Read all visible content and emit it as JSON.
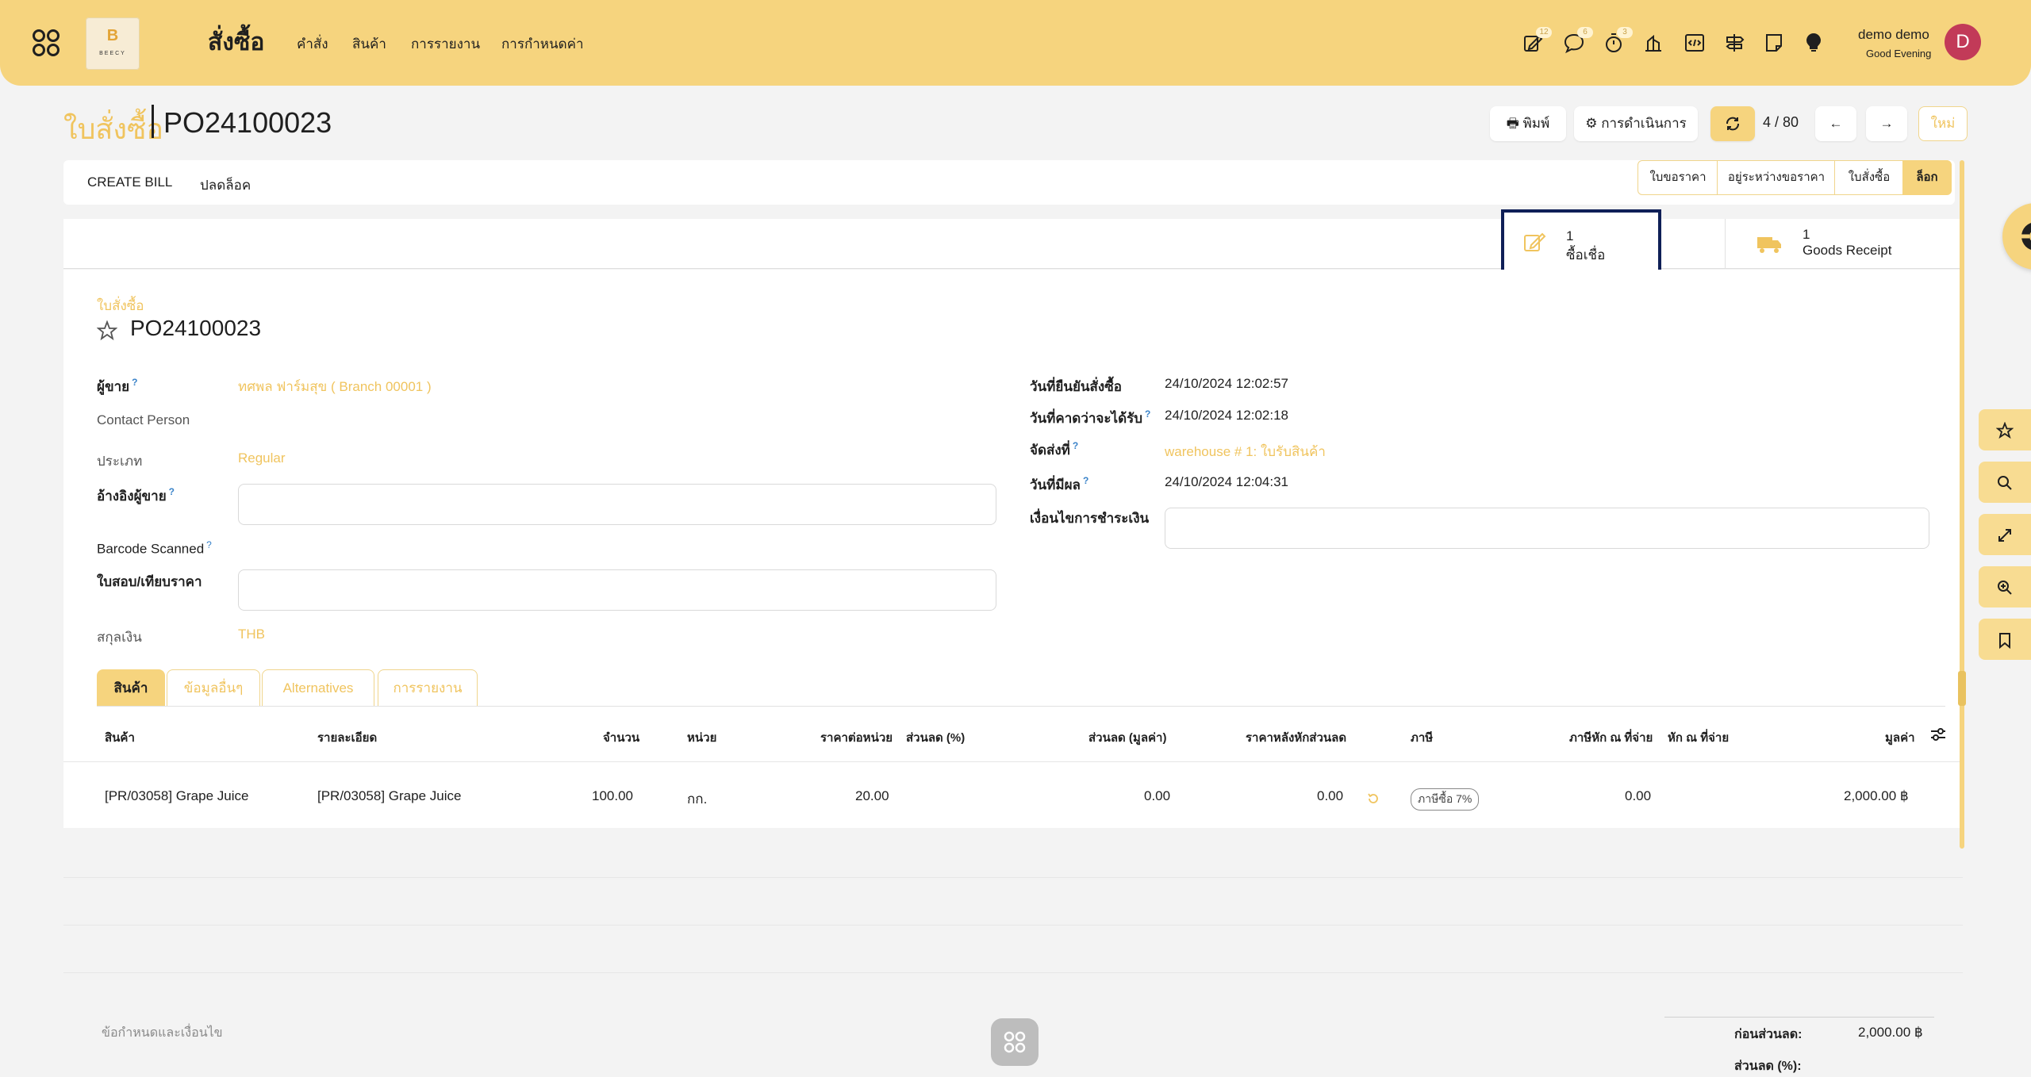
{
  "header": {
    "logo_letter": "B",
    "logo_text": "BEECY",
    "app_title": "สั่งซื้อ",
    "menu": [
      "คำสั่ง",
      "สินค้า",
      "การรายงาน",
      "การกำหนดค่า"
    ],
    "badges": {
      "activity": "12",
      "messages": "6",
      "timer": "3"
    },
    "user_name": "demo demo",
    "greeting": "Good Evening",
    "avatar_letter": "D"
  },
  "breadcrumb": {
    "parent": "ใบสั่งซื้อ",
    "current": "PO24100023"
  },
  "controls": {
    "print": "พิมพ์",
    "action": "การดำเนินการ",
    "pager": "4 / 80",
    "new": "ใหม่"
  },
  "actionbar": {
    "create_bill": "CREATE BILL",
    "unlock": "ปลดล็อค",
    "statuses": [
      "ใบขอราคา",
      "อยู่ระหว่างขอราคา",
      "ใบสั่งซื้อ",
      "ล็อก"
    ],
    "active_status": "ล็อก"
  },
  "smart_buttons": [
    {
      "count": "1",
      "label": "ซื้อเชื่อ",
      "icon": "edit-icon"
    },
    {
      "count": "1",
      "label": "Goods Receipt",
      "icon": "truck-icon"
    }
  ],
  "form": {
    "doc_type": "ใบสั่งซื้อ",
    "doc_number": "PO24100023",
    "left": {
      "vendor_label": "ผู้ขาย",
      "vendor_value": "ทศพล ฟาร์มสุข ( Branch 00001 )",
      "contact_label": "Contact Person",
      "type_label": "ประเภท",
      "type_value": "Regular",
      "vendor_ref_label": "อ้างอิงผู้ขาย",
      "barcode_label": "Barcode Scanned",
      "rfq_label": "ใบสอบ/เทียบราคา",
      "currency_label": "สกุลเงิน",
      "currency_value": "THB"
    },
    "right": {
      "confirm_date_label": "วันที่ยืนยันสั่งซื้อ",
      "confirm_date_value": "24/10/2024 12:02:57",
      "expected_label": "วันที่คาดว่าจะได้รับ",
      "expected_value": "24/10/2024 12:02:18",
      "deliver_label": "จัดส่งที่",
      "deliver_value": "warehouse # 1: ใบรับสินค้า",
      "effective_label": "วันที่มีผล",
      "effective_value": "24/10/2024 12:04:31",
      "payment_terms_label": "เงื่อนไขการชำระเงิน"
    }
  },
  "tabs": [
    "สินค้า",
    "ข้อมูลอื่นๆ",
    "Alternatives",
    "การรายงาน"
  ],
  "table": {
    "headers": [
      "สินค้า",
      "รายละเอียด",
      "จำนวน",
      "หน่วย",
      "ราคาต่อหน่วย",
      "ส่วนลด (%)",
      "ส่วนลด (มูลค่า)",
      "ราคาหลังหักส่วนลด",
      "ภาษี",
      "ภาษีหัก ณ ที่จ่าย",
      "หัก ณ ที่จ่าย",
      "มูลค่า"
    ],
    "rows": [
      {
        "product": "[PR/03058] Grape Juice",
        "description": "[PR/03058] Grape Juice",
        "qty": "100.00",
        "uom": "กก.",
        "unit_price": "20.00",
        "discount_pct": "",
        "discount_amount": "0.00",
        "price_after_discount": "0.00",
        "tax": "ภาษีซื้อ 7%",
        "wht": "0.00",
        "wht2": "",
        "subtotal": "2,000.00 ฿"
      }
    ]
  },
  "footer": {
    "terms_placeholder": "ข้อกำหนดและเงื่อนไข",
    "before_discount_label": "ก่อนส่วนลด:",
    "before_discount_value": "2,000.00 ฿",
    "discount_pct_label": "ส่วนลด (%):"
  }
}
